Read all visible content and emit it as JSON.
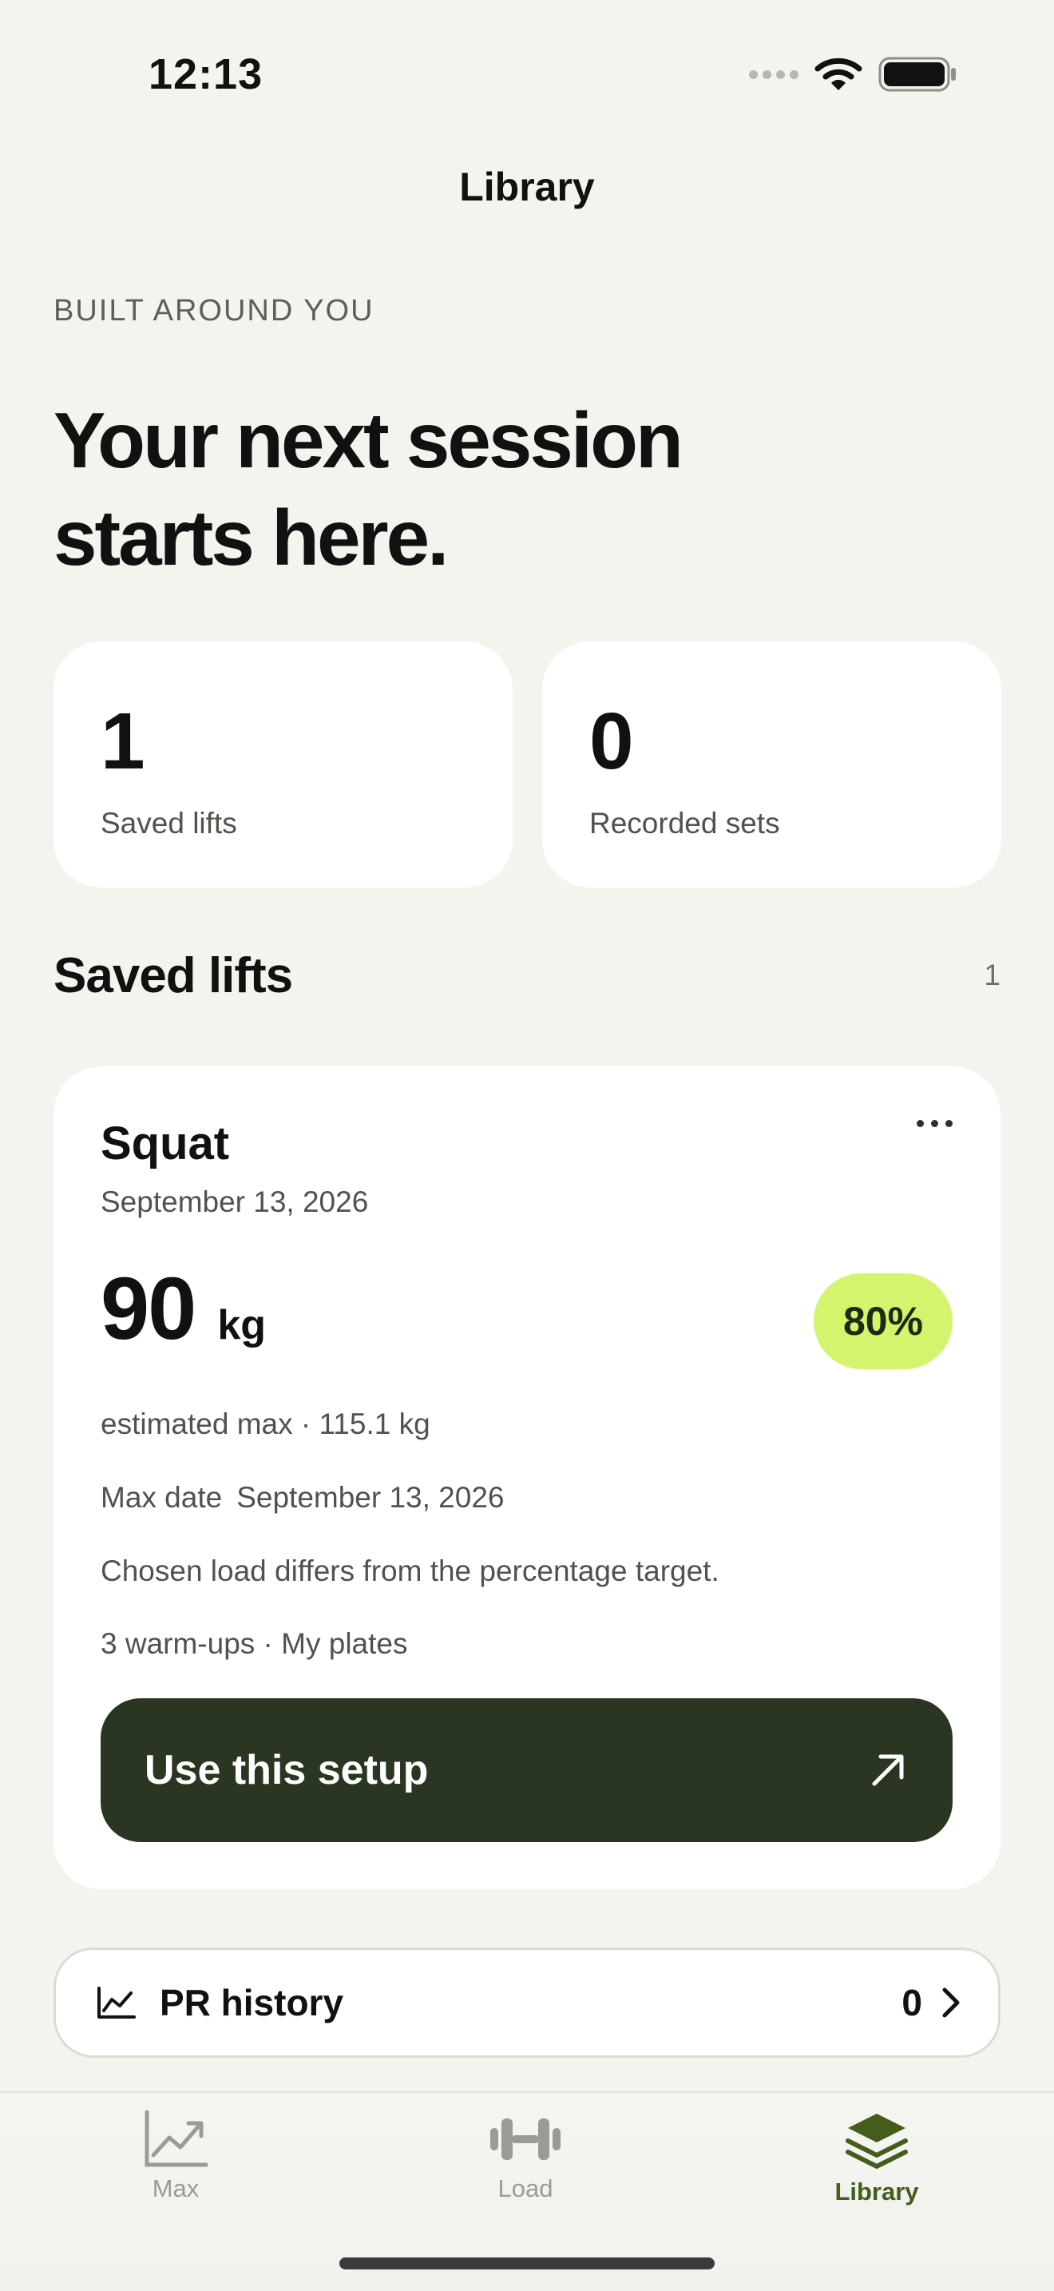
{
  "status": {
    "time": "12:13"
  },
  "nav": {
    "title": "Library"
  },
  "hero": {
    "eyebrow": "BUILT AROUND YOU",
    "line1": "Your next session",
    "line2": "starts here."
  },
  "stats": [
    {
      "value": "1",
      "label": "Saved lifts"
    },
    {
      "value": "0",
      "label": "Recorded sets"
    }
  ],
  "saved_lifts": {
    "title": "Saved lifts",
    "count": "1",
    "items": [
      {
        "name": "Squat",
        "date": "September 13, 2026",
        "weight": "90",
        "unit": "kg",
        "percent": "80%",
        "estimated_max": "estimated max · 115.1 kg",
        "max_date_label": "Max date",
        "max_date_value": "September 13, 2026",
        "note": "Chosen load differs from the percentage target.",
        "warmups": "3 warm-ups · My plates",
        "action_label": "Use this setup"
      }
    ]
  },
  "pr_history": {
    "label": "PR history",
    "count": "0"
  },
  "tabs": [
    {
      "label": "Max",
      "icon": "chart-line-icon",
      "active": false
    },
    {
      "label": "Load",
      "icon": "dumbbell-icon",
      "active": false
    },
    {
      "label": "Library",
      "icon": "stack-layers-icon",
      "active": true
    }
  ],
  "colors": {
    "background": "#f4f4ee",
    "accent_dark": "#2a3621",
    "badge": "#d3f46c",
    "tab_active": "#445c1c"
  }
}
